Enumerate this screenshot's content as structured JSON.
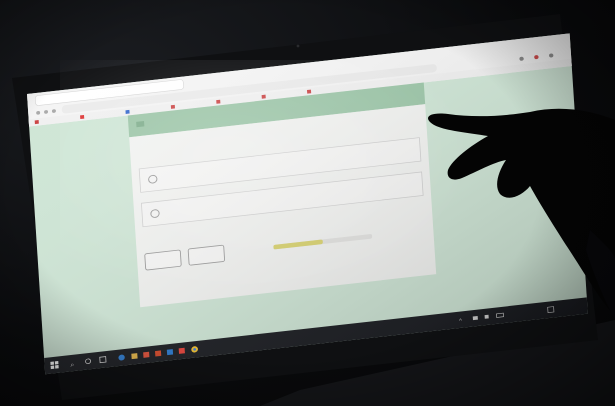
{
  "browser": {
    "tab_title": "",
    "address": "",
    "bookmarks": [
      "",
      "",
      "",
      "",
      "",
      "",
      ""
    ]
  },
  "form": {
    "question": "",
    "options": [
      "",
      ""
    ],
    "back_button": "",
    "next_button": "",
    "progress_label": "",
    "progress_fraction": 0.5
  },
  "taskbar": {
    "weather": "",
    "clock_time": "",
    "clock_date": ""
  },
  "colors": {
    "page_background": "#cfe6d6",
    "form_header": "#9cc6a8",
    "card": "#f2f3f1",
    "progress_fill": "#d8d26b",
    "taskbar": "#1b1d22"
  },
  "icons": [
    "windows-start-icon",
    "search-icon",
    "task-view-icon",
    "edge-icon",
    "file-explorer-icon",
    "chrome-icon",
    "network-icon",
    "volume-icon",
    "battery-icon"
  ]
}
